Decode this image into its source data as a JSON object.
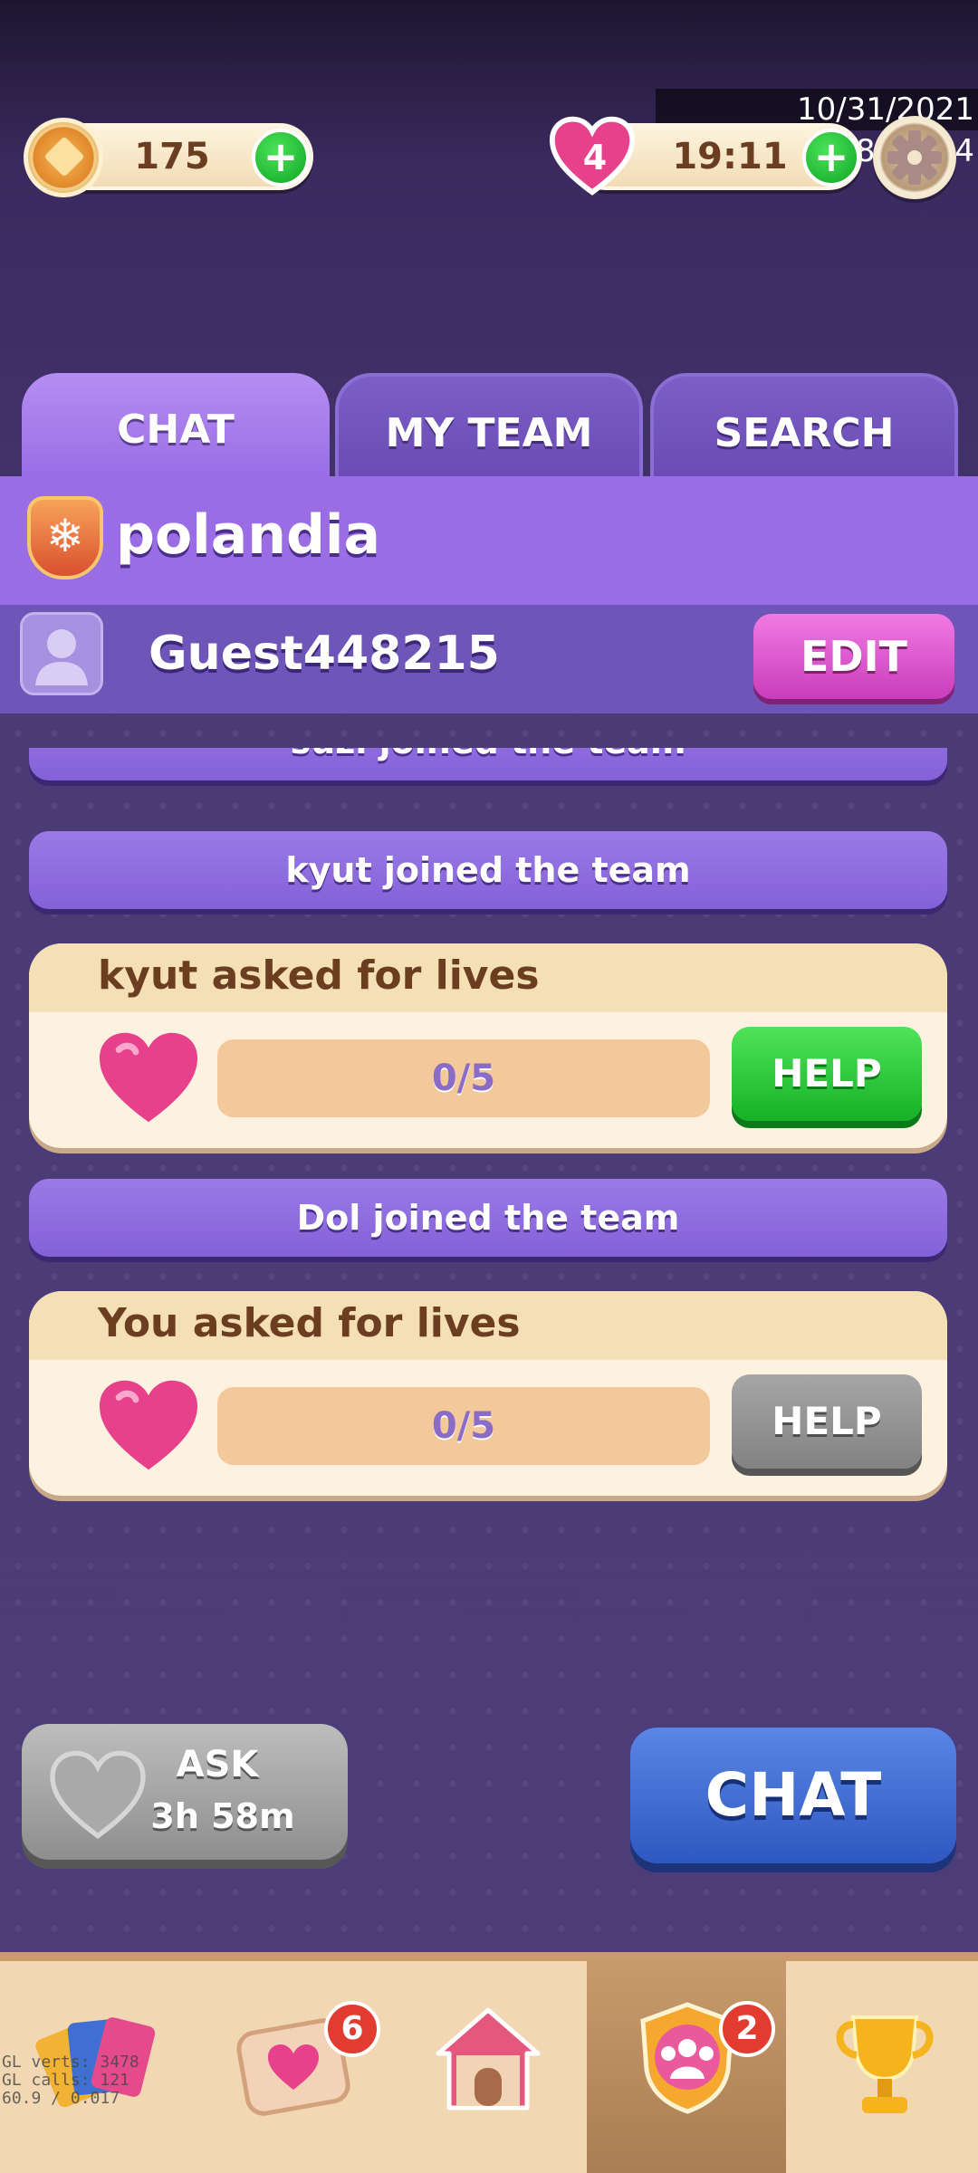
{
  "timestamp": "10/31/2021 18:54:54",
  "currency": {
    "coins": "175",
    "lives": "4",
    "timer": "19:11"
  },
  "tabs": [
    {
      "label": "CHAT",
      "active": true
    },
    {
      "label": "MY TEAM",
      "active": false
    },
    {
      "label": "SEARCH",
      "active": false
    }
  ],
  "team": {
    "name": "polandia"
  },
  "user": {
    "name": "Guest448215",
    "edit_label": "EDIT"
  },
  "feed": [
    {
      "type": "system",
      "text": "suzi joined the team"
    },
    {
      "type": "system",
      "text": "kyut joined the team"
    },
    {
      "type": "request",
      "title": "kyut asked for lives",
      "progress": "0/5",
      "button": "HELP",
      "button_state": "enabled"
    },
    {
      "type": "system",
      "text": "Dol joined the team"
    },
    {
      "type": "request",
      "title": "You asked for lives",
      "progress": "0/5",
      "button": "HELP",
      "button_state": "disabled"
    }
  ],
  "actions": {
    "ask_label": "ASK",
    "ask_timer": "3h 58m",
    "chat_label": "CHAT"
  },
  "nav": {
    "items": [
      "cards-icon",
      "mail-heart-icon",
      "home-icon",
      "team-icon",
      "trophy-icon"
    ],
    "mail_badge": "6",
    "team_badge": "2",
    "active": "team-icon"
  },
  "debug": {
    "line1": "GL verts: 3478",
    "line2": "GL calls: 121",
    "line3": "60.9 / 0.017"
  },
  "colors": {
    "accent": "#9a6de5",
    "help_green": "#16b126",
    "edit_pink": "#c93dba",
    "chat_blue": "#2f58c0"
  }
}
